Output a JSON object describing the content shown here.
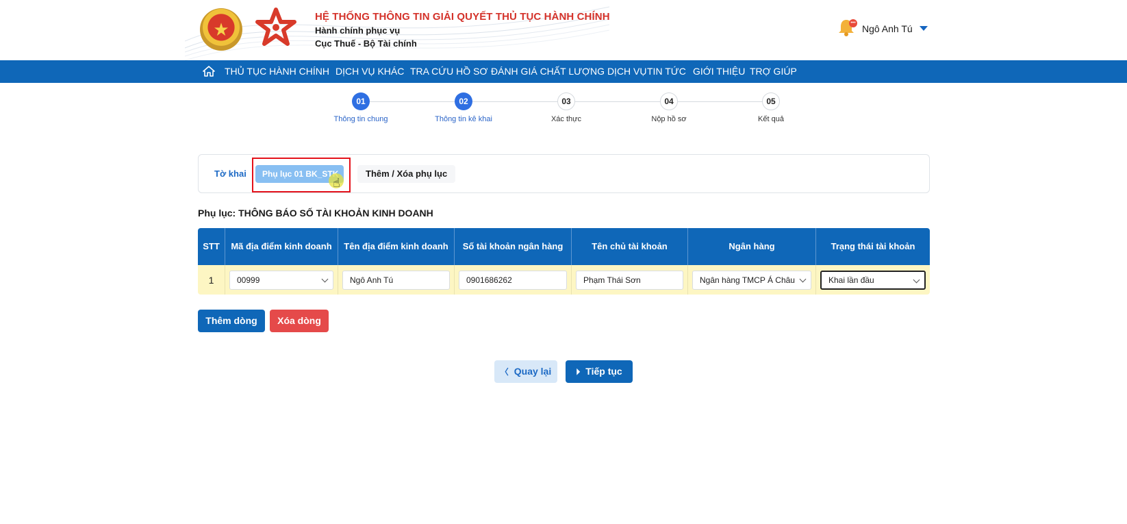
{
  "header": {
    "title": "HỆ THỐNG THÔNG TIN GIẢI QUYẾT THỦ TỤC HÀNH CHÍNH",
    "subtitle1": "Hành chính phục vụ",
    "subtitle2": "Cục Thuế - Bộ Tài chính",
    "user_name": "Ngô Anh Tú",
    "emblem_icon": "national-emblem-icon",
    "logo_icon": "red-star-hands-logo-icon",
    "bell_icon": "bell-icon"
  },
  "nav": {
    "home_icon": "home-icon",
    "items": [
      "THỦ TỤC HÀNH CHÍNH",
      "DỊCH VỤ KHÁC",
      "TRA CỨU HỒ SƠ",
      "ĐÁNH GIÁ CHẤT LƯỢNG DỊCH VỤ",
      "TIN TỨC",
      "GIỚI THIỆU",
      "TRỢ GIÚP"
    ]
  },
  "steps": [
    {
      "num": "01",
      "label": "Thông tin chung",
      "state": "active"
    },
    {
      "num": "02",
      "label": "Thông tin kê khai",
      "state": "active"
    },
    {
      "num": "03",
      "label": "Xác thực",
      "state": "idle"
    },
    {
      "num": "04",
      "label": "Nộp hồ sơ",
      "state": "idle"
    },
    {
      "num": "05",
      "label": "Kết quả",
      "state": "idle"
    }
  ],
  "tabs": {
    "to_khai": "Tờ khai",
    "phu_luc": "Phụ lục 01 BK_STK",
    "add_remove": "Thêm / Xóa phụ lục"
  },
  "section_title": "Phụ lục: THÔNG BÁO SỐ TÀI KHOẢN KINH DOANH",
  "table": {
    "headers": [
      "STT",
      "Mã địa điểm kinh doanh",
      "Tên địa điểm kinh doanh",
      "Số tài khoản ngân hàng",
      "Tên chủ tài khoản",
      "Ngân hàng",
      "Trạng thái tài khoản"
    ],
    "rows": [
      {
        "stt": "1",
        "ma_dia_diem": "00999",
        "ten_dia_diem": "Ngô Anh Tú",
        "so_tai_khoan": "0901686262",
        "ten_chu_tk": "Phạm Thái Sơn",
        "ngan_hang": "Ngân hàng TMCP Á Châu",
        "trang_thai": "Khai lần đầu"
      }
    ]
  },
  "buttons": {
    "add_row": "Thêm dòng",
    "delete_row": "Xóa dòng",
    "back": "Quay lại",
    "next": "Tiếp tục"
  },
  "colors": {
    "primary": "#0f67b8",
    "danger": "#e54a4a",
    "title_red": "#d4322a",
    "row_highlight": "#fdf6c3",
    "tab_active": "#88bff2"
  }
}
